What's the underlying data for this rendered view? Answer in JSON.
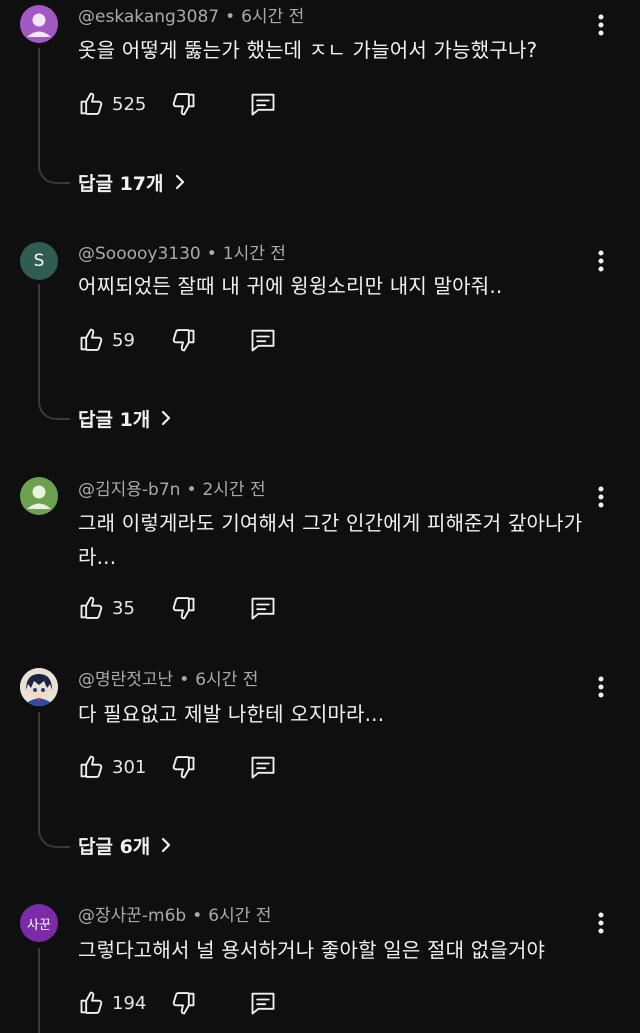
{
  "comments": [
    {
      "handle": "@eskakang3087",
      "time": "6시간 전",
      "text": "옷을 어떻게 뚫는가 했는데 ㅈㄴ 가늘어서 가능했구나?",
      "likes": "525",
      "replies_label": "답글 17개",
      "avatar_color": "#a259c4"
    },
    {
      "handle": "@Sooooy3130",
      "time": "1시간 전",
      "text": "어찌되었든 잘때 내 귀에 윙윙소리만 내지 말아줘..",
      "likes": "59",
      "replies_label": "답글 1개",
      "avatar_letter": "S",
      "avatar_color": "#2f5d50"
    },
    {
      "handle": "@김지용-b7n",
      "time": "2시간 전",
      "text": "그래 이렇게라도 기여해서 그간 인간에게 피해준거 갚아나가라...",
      "likes": "35",
      "avatar_color": "#6ea14f"
    },
    {
      "handle": "@명란젓고난",
      "time": "6시간 전",
      "text": "다 필요없고 제발 나한테 오지마라...",
      "likes": "301",
      "replies_label": "답글 6개",
      "avatar_color": "#d9cfc0"
    },
    {
      "handle": "@장사꾼-m6b",
      "time": "6시간 전",
      "text": "그렇다고해서 널 용서하거나 좋아할 일은 절대 없을거야",
      "likes": "194",
      "avatar_text": "사꾼",
      "avatar_color": "#7b2aa8"
    }
  ],
  "meta_separator": "•",
  "icons": {
    "like": "thumbs-up-icon",
    "dislike": "thumbs-down-icon",
    "reply": "comment-icon",
    "more": "more-vertical-icon",
    "chevron": "chevron-right-icon"
  }
}
